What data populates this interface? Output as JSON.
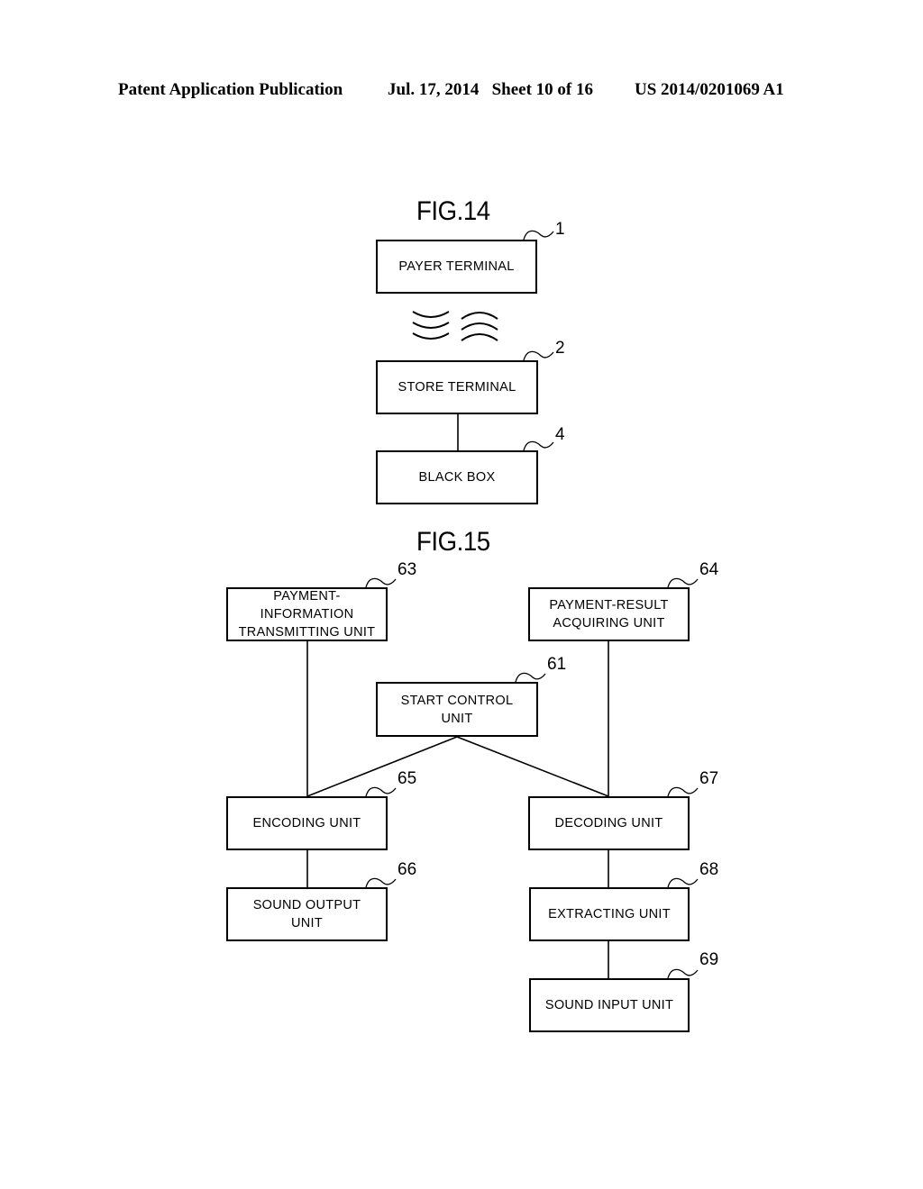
{
  "header": {
    "publication": "Patent Application Publication",
    "date_sheet": "Jul. 17, 2014   Sheet 10 of 16",
    "patent_number": "US 2014/0201069 A1"
  },
  "fig14": {
    "title": "FIG.14",
    "blocks": [
      {
        "id": "payer-terminal",
        "label": "PAYER TERMINAL",
        "ref": "1"
      },
      {
        "id": "store-terminal",
        "label": "STORE TERMINAL",
        "ref": "2"
      },
      {
        "id": "black-box",
        "label": "BLACK BOX",
        "ref": "4"
      }
    ],
    "wireless_symbol": "sound-wave-icon",
    "connections": [
      [
        "store-terminal",
        "black-box"
      ]
    ]
  },
  "fig15": {
    "title": "FIG.15",
    "blocks": [
      {
        "id": "payment-information-transmitting-unit",
        "label": "PAYMENT-\nINFORMATION\nTRANSMITTING UNIT",
        "ref": "63"
      },
      {
        "id": "payment-result-acquiring-unit",
        "label": "PAYMENT-RESULT\nACQUIRING UNIT",
        "ref": "64"
      },
      {
        "id": "start-control-unit",
        "label": "START CONTROL\nUNIT",
        "ref": "61"
      },
      {
        "id": "encoding-unit",
        "label": "ENCODING UNIT",
        "ref": "65"
      },
      {
        "id": "decoding-unit",
        "label": "DECODING UNIT",
        "ref": "67"
      },
      {
        "id": "sound-output-unit",
        "label": "SOUND OUTPUT\nUNIT",
        "ref": "66"
      },
      {
        "id": "extracting-unit",
        "label": "EXTRACTING UNIT",
        "ref": "68"
      },
      {
        "id": "sound-input-unit",
        "label": "SOUND INPUT UNIT",
        "ref": "69"
      }
    ],
    "connections": [
      [
        "payment-information-transmitting-unit",
        "encoding-unit"
      ],
      [
        "payment-result-acquiring-unit",
        "decoding-unit"
      ],
      [
        "start-control-unit",
        "encoding-unit"
      ],
      [
        "start-control-unit",
        "decoding-unit"
      ],
      [
        "encoding-unit",
        "sound-output-unit"
      ],
      [
        "decoding-unit",
        "extracting-unit"
      ],
      [
        "extracting-unit",
        "sound-input-unit"
      ]
    ]
  }
}
